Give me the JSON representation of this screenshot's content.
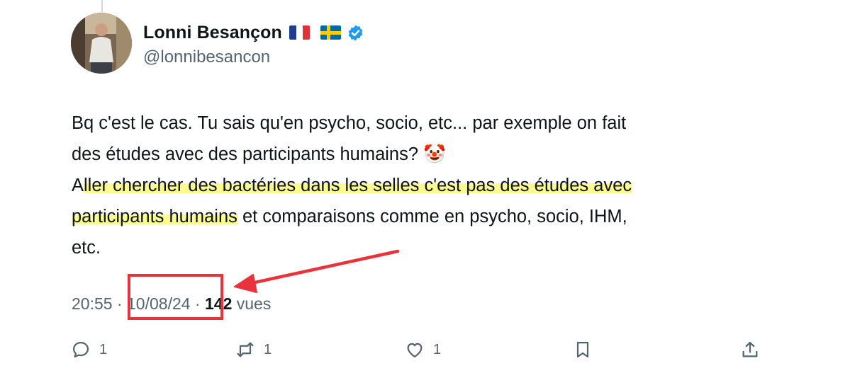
{
  "author": {
    "display_name": "Lonni Besançon",
    "handle": "@lonnibesancon",
    "flags": [
      "flag-france",
      "flag-sweden"
    ],
    "verified": true
  },
  "tweet": {
    "line1": "Bq c'est le cas. Tu sais qu'en psycho, socio, etc... par exemple on fait",
    "line2": "des études avec des participants humains? 🤡",
    "line3_prefix": "A",
    "line3_highlight": "ller chercher des bactéries dans les selles c'est pas des études avec",
    "line4_highlight": "participants humains",
    "line4_rest": " et comparaisons comme en psycho, socio, IHM,",
    "line5": "etc."
  },
  "meta": {
    "time": "20:55",
    "separator": " · ",
    "date": "10/08/24",
    "views_count": "142",
    "views_label": " vues"
  },
  "actions": {
    "reply_count": "1",
    "retweet_count": "1",
    "like_count": "1"
  },
  "colors": {
    "annotation_red": "#e8333c",
    "highlight_yellow": "#fbfb90",
    "verified_blue": "#1d9bf0",
    "secondary_text": "#536471"
  }
}
